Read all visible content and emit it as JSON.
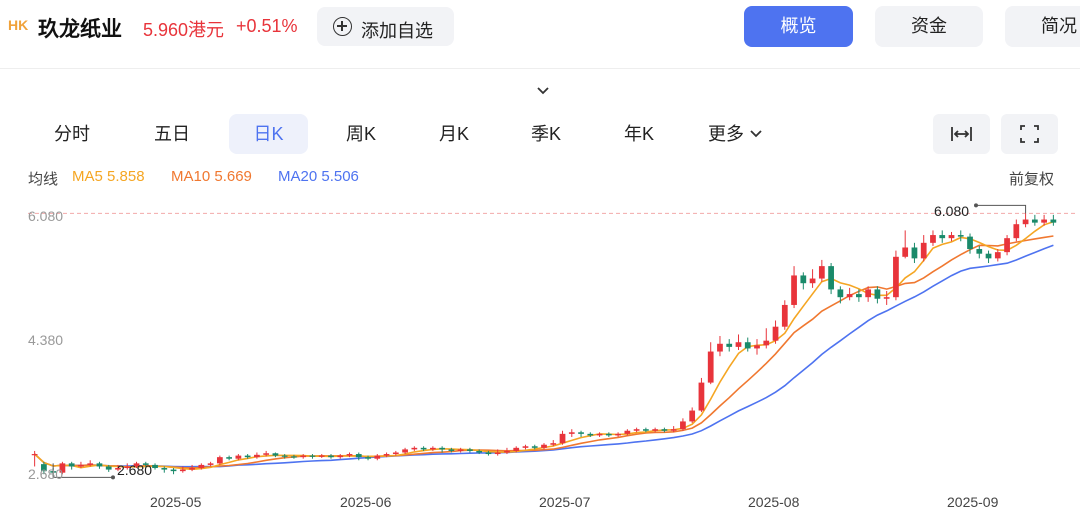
{
  "header": {
    "market_badge": "HK",
    "stock_name": "玖龙纸业",
    "price": "5.960港元",
    "change_pct": "+0.51%",
    "add_watchlist_label": "添加自选",
    "tabs": [
      "概览",
      "资金",
      "简况"
    ]
  },
  "periods": [
    "分时",
    "五日",
    "日K",
    "周K",
    "月K",
    "季K",
    "年K",
    "更多"
  ],
  "active_period": "日K",
  "ma_legend": {
    "label": "均线",
    "ma5": "MA5 5.858",
    "ma10": "MA10 5.669",
    "ma20": "MA20 5.506",
    "colors": {
      "ma5": "#f5a623",
      "ma10": "#f07830",
      "ma20": "#4e73f0"
    }
  },
  "adjust_label": "前复权",
  "colors": {
    "up": "#e8343b",
    "down": "#1a8a6a",
    "accent": "#4e73f0"
  },
  "icons": [
    "plus-circle-icon",
    "chevron-down-icon",
    "fit-width-icon",
    "fullscreen-icon"
  ],
  "chart_data": {
    "type": "candlestick",
    "title": "",
    "y_tick_labels": [
      "6.080",
      "4.380",
      "2.680"
    ],
    "ylim": [
      2.62,
      6.2
    ],
    "x_tick_labels": [
      "2025-05",
      "2025-06",
      "2025-07",
      "2025-08",
      "2025-09"
    ],
    "high_marker": "6.080",
    "low_marker": "2.680",
    "candles": [
      [
        2.98,
        2.98,
        3.02,
        2.82
      ],
      [
        2.85,
        2.76,
        2.88,
        2.72
      ],
      [
        2.76,
        2.74,
        2.8,
        2.7
      ],
      [
        2.74,
        2.86,
        2.88,
        2.72
      ],
      [
        2.86,
        2.82,
        2.88,
        2.78
      ],
      [
        2.82,
        2.84,
        2.88,
        2.8
      ],
      [
        2.84,
        2.86,
        2.9,
        2.82
      ],
      [
        2.86,
        2.82,
        2.88,
        2.79
      ],
      [
        2.82,
        2.78,
        2.84,
        2.75
      ],
      [
        2.78,
        2.8,
        2.84,
        2.76
      ],
      [
        2.8,
        2.82,
        2.86,
        2.78
      ],
      [
        2.82,
        2.86,
        2.88,
        2.8
      ],
      [
        2.86,
        2.84,
        2.88,
        2.82
      ],
      [
        2.84,
        2.8,
        2.86,
        2.78
      ],
      [
        2.8,
        2.78,
        2.82,
        2.74
      ],
      [
        2.78,
        2.76,
        2.8,
        2.72
      ],
      [
        2.76,
        2.78,
        2.82,
        2.74
      ],
      [
        2.78,
        2.8,
        2.84,
        2.76
      ],
      [
        2.8,
        2.84,
        2.86,
        2.78
      ],
      [
        2.84,
        2.86,
        2.88,
        2.82
      ],
      [
        2.86,
        2.94,
        2.96,
        2.84
      ],
      [
        2.94,
        2.92,
        2.96,
        2.9
      ],
      [
        2.92,
        2.96,
        2.98,
        2.9
      ],
      [
        2.96,
        2.94,
        2.98,
        2.92
      ],
      [
        2.94,
        2.97,
        3.0,
        2.92
      ],
      [
        2.97,
        2.99,
        3.02,
        2.95
      ],
      [
        2.99,
        2.96,
        3.0,
        2.94
      ],
      [
        2.96,
        2.95,
        2.98,
        2.92
      ],
      [
        2.95,
        2.94,
        2.97,
        2.92
      ],
      [
        2.94,
        2.96,
        2.98,
        2.92
      ],
      [
        2.96,
        2.95,
        2.98,
        2.92
      ],
      [
        2.95,
        2.96,
        2.98,
        2.93
      ],
      [
        2.96,
        2.94,
        2.98,
        2.92
      ],
      [
        2.94,
        2.96,
        2.98,
        2.92
      ],
      [
        2.96,
        2.98,
        3.0,
        2.94
      ],
      [
        2.98,
        2.94,
        3.0,
        2.9
      ],
      [
        2.94,
        2.92,
        2.96,
        2.9
      ],
      [
        2.92,
        2.96,
        2.98,
        2.9
      ],
      [
        2.96,
        2.98,
        3.0,
        2.94
      ],
      [
        2.98,
        3.0,
        3.02,
        2.96
      ],
      [
        3.0,
        3.04,
        3.06,
        2.98
      ],
      [
        3.04,
        3.06,
        3.08,
        3.02
      ],
      [
        3.06,
        3.04,
        3.08,
        3.02
      ],
      [
        3.04,
        3.06,
        3.08,
        3.02
      ],
      [
        3.06,
        3.04,
        3.08,
        3.0
      ],
      [
        3.04,
        3.02,
        3.06,
        3.0
      ],
      [
        3.02,
        3.04,
        3.06,
        3.0
      ],
      [
        3.04,
        3.02,
        3.06,
        3.0
      ],
      [
        3.02,
        3.0,
        3.04,
        2.98
      ],
      [
        3.0,
        2.98,
        3.02,
        2.96
      ],
      [
        2.98,
        3.0,
        3.04,
        2.96
      ],
      [
        3.0,
        3.02,
        3.06,
        2.98
      ],
      [
        3.02,
        3.06,
        3.08,
        3.0
      ],
      [
        3.06,
        3.08,
        3.1,
        3.04
      ],
      [
        3.08,
        3.06,
        3.1,
        3.04
      ],
      [
        3.06,
        3.1,
        3.12,
        3.04
      ],
      [
        3.1,
        3.12,
        3.16,
        3.08
      ],
      [
        3.12,
        3.24,
        3.28,
        3.1
      ],
      [
        3.24,
        3.26,
        3.3,
        3.2
      ],
      [
        3.26,
        3.24,
        3.28,
        3.2
      ],
      [
        3.24,
        3.22,
        3.26,
        3.2
      ],
      [
        3.22,
        3.24,
        3.26,
        3.2
      ],
      [
        3.24,
        3.22,
        3.26,
        3.2
      ],
      [
        3.22,
        3.24,
        3.26,
        3.2
      ],
      [
        3.24,
        3.28,
        3.3,
        3.22
      ],
      [
        3.28,
        3.3,
        3.32,
        3.26
      ],
      [
        3.3,
        3.28,
        3.32,
        3.26
      ],
      [
        3.28,
        3.3,
        3.32,
        3.26
      ],
      [
        3.3,
        3.28,
        3.32,
        3.26
      ],
      [
        3.28,
        3.3,
        3.34,
        3.26
      ],
      [
        3.3,
        3.4,
        3.44,
        3.28
      ],
      [
        3.4,
        3.54,
        3.58,
        3.38
      ],
      [
        3.54,
        3.9,
        3.96,
        3.52
      ],
      [
        3.9,
        4.3,
        4.42,
        3.88
      ],
      [
        4.3,
        4.4,
        4.5,
        4.24
      ],
      [
        4.4,
        4.36,
        4.46,
        4.3
      ],
      [
        4.36,
        4.42,
        4.52,
        4.32
      ],
      [
        4.42,
        4.34,
        4.48,
        4.3
      ],
      [
        4.34,
        4.38,
        4.46,
        4.26
      ],
      [
        4.38,
        4.44,
        4.6,
        4.34
      ],
      [
        4.44,
        4.62,
        4.7,
        4.4
      ],
      [
        4.62,
        4.9,
        4.96,
        4.58
      ],
      [
        4.9,
        5.28,
        5.4,
        4.86
      ],
      [
        5.28,
        5.18,
        5.32,
        5.1
      ],
      [
        5.18,
        5.24,
        5.36,
        5.12
      ],
      [
        5.24,
        5.4,
        5.48,
        5.2
      ],
      [
        5.4,
        5.1,
        5.44,
        5.04
      ],
      [
        5.1,
        5.0,
        5.14,
        4.92
      ],
      [
        5.0,
        5.04,
        5.12,
        4.96
      ],
      [
        5.04,
        5.0,
        5.1,
        4.94
      ],
      [
        5.0,
        5.1,
        5.14,
        4.94
      ],
      [
        5.1,
        4.98,
        5.14,
        4.92
      ],
      [
        4.98,
        5.0,
        5.08,
        4.9
      ],
      [
        5.0,
        5.52,
        5.6,
        4.96
      ],
      [
        5.52,
        5.64,
        5.86,
        5.5
      ],
      [
        5.64,
        5.5,
        5.7,
        5.44
      ],
      [
        5.5,
        5.7,
        5.8,
        5.46
      ],
      [
        5.7,
        5.8,
        5.86,
        5.66
      ],
      [
        5.8,
        5.76,
        5.86,
        5.7
      ],
      [
        5.76,
        5.8,
        5.84,
        5.72
      ],
      [
        5.8,
        5.78,
        5.86,
        5.72
      ],
      [
        5.78,
        5.62,
        5.82,
        5.56
      ],
      [
        5.62,
        5.56,
        5.66,
        5.5
      ],
      [
        5.56,
        5.5,
        5.6,
        5.44
      ],
      [
        5.5,
        5.58,
        5.62,
        5.46
      ],
      [
        5.58,
        5.76,
        5.8,
        5.54
      ],
      [
        5.76,
        5.94,
        6.0,
        5.72
      ],
      [
        5.94,
        6.0,
        6.08,
        5.9
      ],
      [
        6.0,
        5.96,
        6.06,
        5.92
      ],
      [
        5.96,
        6.0,
        6.06,
        5.92
      ],
      [
        6.0,
        5.96,
        6.06,
        5.92
      ]
    ],
    "ma5_final": 5.858,
    "ma10_final": 5.669,
    "ma20_final": 5.506
  }
}
